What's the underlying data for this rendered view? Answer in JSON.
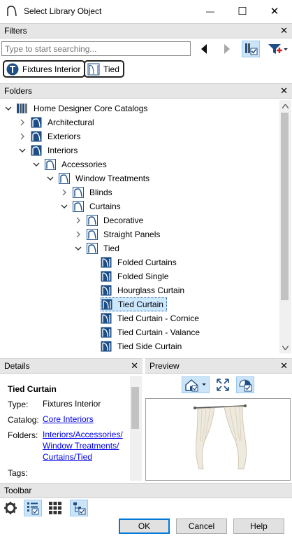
{
  "window": {
    "title": "Select Library Object",
    "minimize_glyph": "—",
    "maximize_glyph": "☐",
    "close_glyph": "✕"
  },
  "filters": {
    "header": "Filters",
    "search_placeholder": "Type to start searching...",
    "chips": [
      {
        "label": "Fixtures Interior",
        "icon": "fixtures-circle-icon"
      },
      {
        "label": "Tied",
        "icon": "tied-curtain-icon"
      }
    ]
  },
  "folders": {
    "header": "Folders",
    "tree": [
      {
        "label": "Home Designer Core Catalogs",
        "level": 0,
        "expander": "open",
        "icon": "catalogs-books-icon"
      },
      {
        "label": "Architectural",
        "level": 1,
        "expander": "closed",
        "icon": "catalog-dark-icon"
      },
      {
        "label": "Exteriors",
        "level": 1,
        "expander": "closed",
        "icon": "catalog-dark-icon"
      },
      {
        "label": "Interiors",
        "level": 1,
        "expander": "open",
        "icon": "catalog-dark-icon"
      },
      {
        "label": "Accessories",
        "level": 2,
        "expander": "open",
        "icon": "folder-icon"
      },
      {
        "label": "Window Treatments",
        "level": 3,
        "expander": "open",
        "icon": "folder-icon"
      },
      {
        "label": "Blinds",
        "level": 4,
        "expander": "closed",
        "icon": "folder-icon"
      },
      {
        "label": "Curtains",
        "level": 4,
        "expander": "open",
        "icon": "folder-icon"
      },
      {
        "label": "Decorative",
        "level": 5,
        "expander": "closed",
        "icon": "folder-icon"
      },
      {
        "label": "Straight Panels",
        "level": 5,
        "expander": "closed",
        "icon": "folder-icon"
      },
      {
        "label": "Tied",
        "level": 5,
        "expander": "open",
        "icon": "folder-icon"
      },
      {
        "label": "Folded Curtains",
        "level": 6,
        "expander": "none",
        "icon": "object-icon"
      },
      {
        "label": "Folded Single",
        "level": 6,
        "expander": "none",
        "icon": "object-icon"
      },
      {
        "label": "Hourglass Curtain",
        "level": 6,
        "expander": "none",
        "icon": "object-icon"
      },
      {
        "label": "Tied Curtain",
        "level": 6,
        "expander": "none",
        "icon": "object-icon",
        "selected": true
      },
      {
        "label": "Tied Curtain - Cornice",
        "level": 6,
        "expander": "none",
        "icon": "object-icon"
      },
      {
        "label": "Tied Curtain - Valance",
        "level": 6,
        "expander": "none",
        "icon": "object-icon"
      },
      {
        "label": "Tied Side Curtain",
        "level": 6,
        "expander": "none",
        "icon": "object-icon"
      }
    ]
  },
  "details": {
    "header": "Details",
    "title": "Tied Curtain",
    "type_label": "Type:",
    "type_value": "Fixtures Interior",
    "catalog_label": "Catalog:",
    "catalog_value": "Core Interiors",
    "folders_label": "Folders:",
    "folders_lines": [
      "Interiors/Accessories/",
      "Window Treatments/",
      "Curtains/Tied"
    ],
    "tags_label": "Tags:"
  },
  "preview": {
    "header": "Preview"
  },
  "toolbar": {
    "header": "Toolbar"
  },
  "buttons": {
    "ok": "OK",
    "cancel": "Cancel",
    "help": "Help"
  },
  "colors": {
    "accent": "#1d4f86",
    "selection": "#cce8ff",
    "link": "#0000ee"
  }
}
